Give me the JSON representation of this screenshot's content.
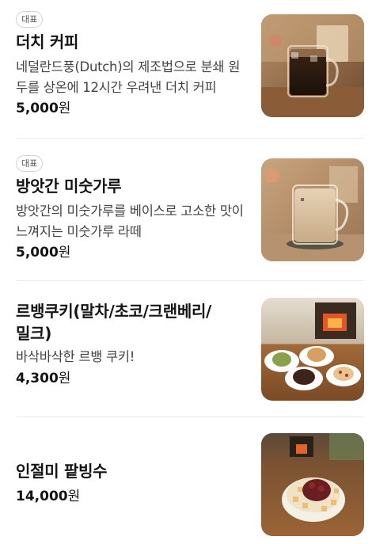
{
  "menu": {
    "items": [
      {
        "badge": "대표",
        "name": "더치 커피",
        "description": "네덜란드풍(Dutch)의 제조법으로 분쇄 원두를 상온에 12시간 우려낸 더치 커피",
        "price_number": "5,000",
        "price_unit": "원",
        "image": "iced-dutch-coffee-photo"
      },
      {
        "badge": "대표",
        "name": "방앗간 미숫가루",
        "description": "방앗간의 미숫가루를 베이스로 고소한 맛이 느껴지는 미숫가루 라떼",
        "price_number": "5,000",
        "price_unit": "원",
        "image": "misugaru-latte-photo"
      },
      {
        "name": "르뱅쿠키(말차/초코/크랜베리/밀크)",
        "description": "바삭바삭한 르뱅 쿠키!",
        "price_number": "4,300",
        "price_unit": "원",
        "image": "levain-cookies-photo"
      },
      {
        "name": "인절미 팥빙수",
        "price_number": "14,000",
        "price_unit": "원",
        "image": "injeolmi-bingsu-photo"
      }
    ]
  }
}
